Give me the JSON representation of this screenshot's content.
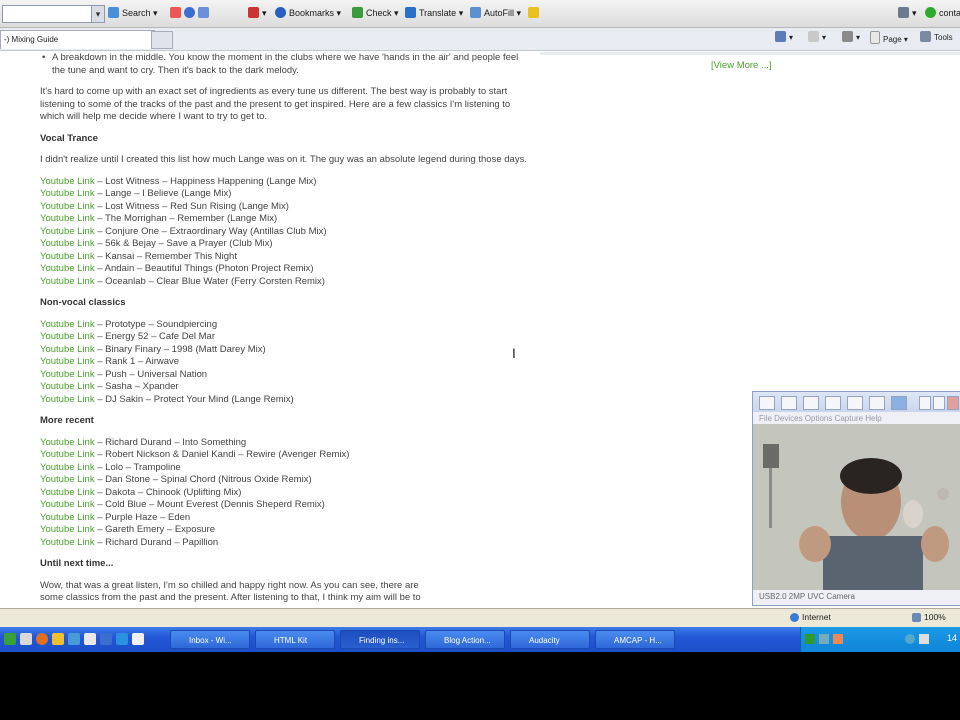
{
  "toolbar": {
    "search_label": "Search",
    "bookmarks_label": "Bookmarks",
    "check_label": "Check",
    "translate_label": "Translate",
    "autofill_label": "AutoFill",
    "contact_label": "conta"
  },
  "tab": {
    "label": "-) Mixing Guide"
  },
  "commandbar": {
    "page_label": "Page",
    "tools_label": "Tools"
  },
  "article": {
    "bullet": "A breakdown in the middle. You know the moment in the clubs where we have 'hands in the air' and people feel the tune and want to cry. Then it's back to the dark melody.",
    "intro": "It's hard to come up with an exact set of ingredients as every tune us different. The best way is probably to start listening to some of the tracks of the past and the present to get inspired. Here are a few classics I'm listening to which will help me decide where I want to try to get to.",
    "sections": [
      {
        "heading": "Vocal Trance",
        "note": "I didn't realize until I created this list how much Lange was on it. The guy was an absolute legend during those days.",
        "links": [
          "Lost Witness – Happiness Happening (Lange Mix)",
          "Lange – I Believe (Lange Mix)",
          "Lost Witness – Red Sun Rising (Lange Mix)",
          "The Morrighan – Remember (Lange Mix)",
          "Conjure One – Extraordinary Way (Antillas Club Mix)",
          "56k & Bejay – Save a Prayer (Club Mix)",
          "Kansai – Remember This Night",
          "Andain – Beautiful Things (Photon Project Remix)",
          "Oceanlab – Clear Blue Water (Ferry Corsten Remix)"
        ]
      },
      {
        "heading": "Non-vocal classics",
        "note": "",
        "links": [
          "Prototype – Soundpiercing",
          "Energy 52 – Cafe Del Mar",
          "Binary Finary – 1998 (Matt Darey Mix)",
          "Rank 1 – Airwave",
          "Push – Universal Nation",
          "Sasha – Xpander",
          "DJ Sakin – Protect Your Mind (Lange Remix)"
        ]
      },
      {
        "heading": "More recent",
        "note": "",
        "links": [
          "Richard Durand – Into Something",
          "Robert Nickson & Daniel Kandi – Rewire (Avenger Remix)",
          "Lolo – Trampoline",
          "Dan Stone – Spinal Chord (Nitrous Oxide Remix)",
          "Dakota – Chinook (Uplifting Mix)",
          "Cold Blue – Mount Everest (Dennis Sheperd Remix)",
          "Purple Haze – Eden",
          "Gareth Emery – Exposure",
          "Richard Durand – Papillion"
        ]
      }
    ],
    "link_label": "Youtube Link",
    "closing_heading": "Until next time...",
    "closing_line1": "Wow, that was a great listen, I'm so chilled and happy right now. As you can see, there are",
    "closing_line2": "some classics from the past and the present. After listening to that, I think my aim will be to"
  },
  "sidebar": {
    "view_more": "[View More ...]"
  },
  "cam": {
    "menu": "File  Devices  Options  Capture  Help",
    "status": "USB2.0 2MP UVC Camera"
  },
  "statusbar": {
    "zone": "Internet",
    "zoom": "100%"
  },
  "taskbar": {
    "tasks": [
      "Inbox - Wi...",
      "HTML Kit",
      "Finding ins...",
      "Blog Action...",
      "Audacity",
      "AMCAP - H..."
    ],
    "tray_time": "14"
  }
}
